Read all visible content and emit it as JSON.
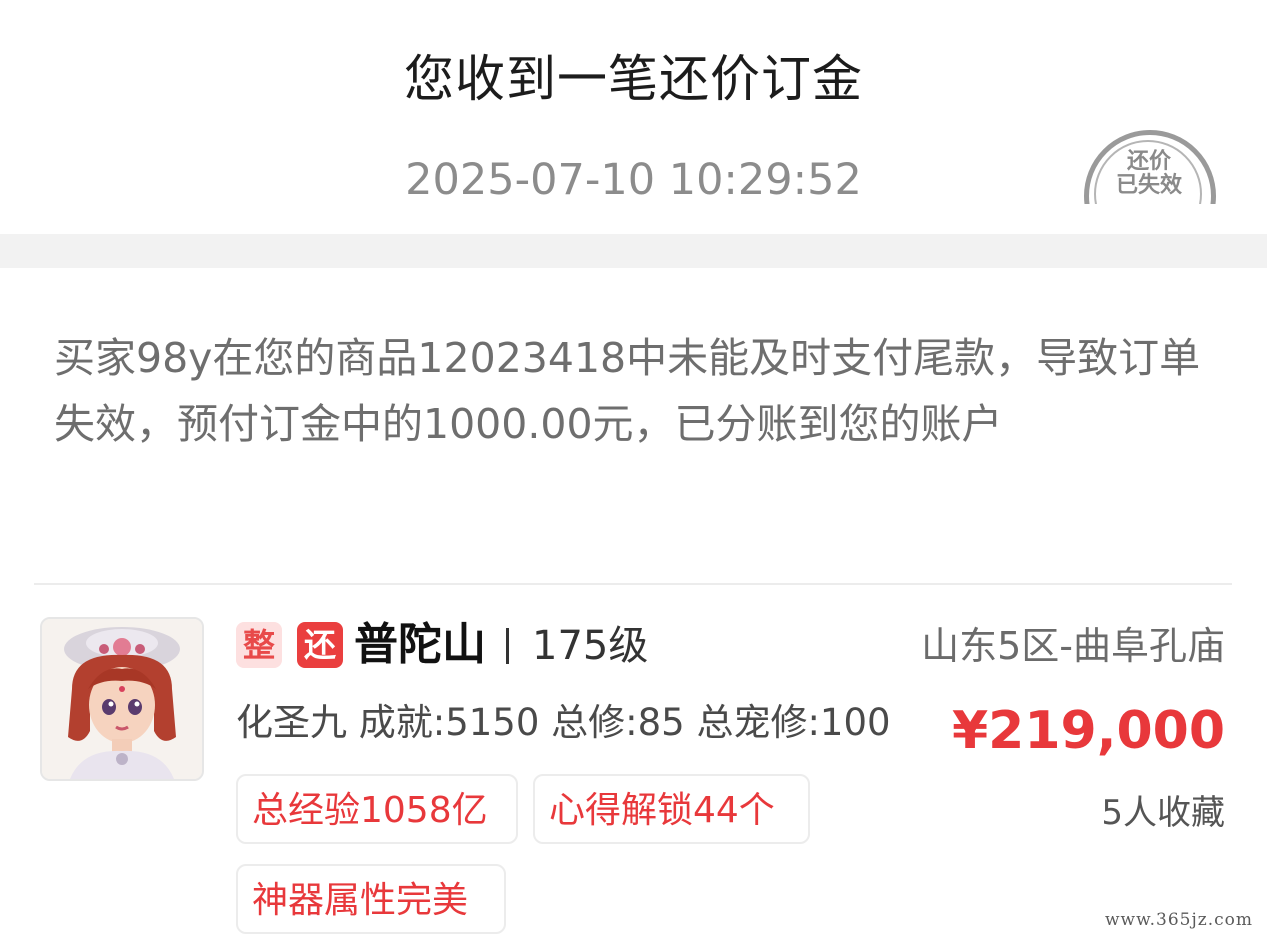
{
  "header": {
    "title": "您收到一笔还价订金",
    "timestamp": "2025-07-10 10:29:52",
    "stamp_line1": "还价",
    "stamp_line2": "已失效"
  },
  "message": {
    "text": "买家98y在您的商品12023418中未能及时支付尾款，导致订单失效，预付订金中的1000.00元，已分账到您的账户"
  },
  "item": {
    "badge_whole": "整",
    "badge_bargain": "还",
    "server_name": "普陀山",
    "level": "175级",
    "region": "山东5区-曲阜孔庙",
    "stats": "化圣九 成就:5150 总修:85 总宠修:100",
    "price": "¥219,000",
    "favorites": "5人收藏",
    "tags": [
      "总经验1058亿",
      "心得解锁44个",
      "神器属性完美"
    ]
  },
  "watermark": "www.365jz.com",
  "colors": {
    "accent_red": "#e8383b",
    "badge_light_bg": "#fde0e0",
    "stamp_gray": "#9a9a9a",
    "divider_gray": "#f2f2f2"
  }
}
